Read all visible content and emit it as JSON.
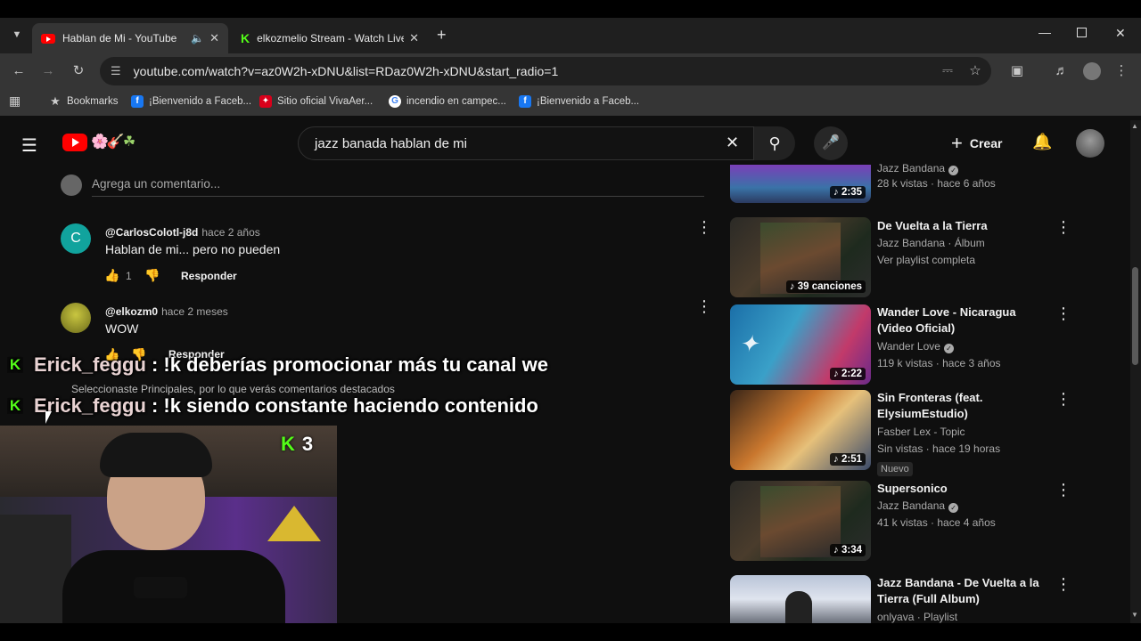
{
  "browser": {
    "tabs": [
      {
        "title": "Hablan de Mi - YouTube",
        "icon": "youtube-icon"
      },
      {
        "title": "elkozmelio Stream - Watch Live",
        "icon": "kick-icon"
      }
    ],
    "address": "youtube.com/watch?v=az0W2h-xDNU&list=RDaz0W2h-xDNU&start_radio=1",
    "bookmarks": [
      {
        "label": "Bookmarks",
        "icon": "star-icon"
      },
      {
        "label": "¡Bienvenido a Faceb...",
        "icon": "facebook-icon"
      },
      {
        "label": "Sitio oficial VivaAer...",
        "icon": "vivaaerobus-icon"
      },
      {
        "label": "incendio en campec...",
        "icon": "google-icon"
      },
      {
        "label": "¡Bienvenido a Faceb...",
        "icon": "facebook-icon"
      }
    ]
  },
  "youtube": {
    "search_query": "jazz banada hablan de mi",
    "create_label": "Crear",
    "add_comment_placeholder": "Agrega un comentario...",
    "comments": [
      {
        "avatar_letter": "C",
        "author": "@CarlosColotl-j8d",
        "time": "hace 2 años",
        "text": "Hablan de mi... pero no pueden",
        "likes": "1",
        "reply_label": "Responder"
      },
      {
        "author": "@elkozm0",
        "time": "hace 2 meses",
        "text": "WOW",
        "reply_label": "Responder"
      }
    ],
    "featured_note": "Seleccionaste Principales, por lo que verás comentarios destacados",
    "sidebar": [
      {
        "title": "",
        "channel": "Jazz Bandana",
        "meta": "28 k vistas · hace 6 años",
        "duration": "2:35",
        "verified": true
      },
      {
        "title": "De Vuelta a la Tierra",
        "channel": "Jazz Bandana · Álbum",
        "meta": "Ver playlist completa",
        "duration": "39 canciones"
      },
      {
        "title": "Wander Love - Nicaragua (Video Oficial)",
        "channel": "Wander Love",
        "meta": "119 k vistas · hace 3 años",
        "duration": "2:22",
        "verified": true
      },
      {
        "title": "Sin Fronteras (feat. ElysiumEstudio)",
        "channel": "Fasber Lex - Topic",
        "meta": "Sin vistas · hace 19 horas",
        "badge": "Nuevo",
        "duration": "2:51"
      },
      {
        "title": "Supersonico",
        "channel": "Jazz Bandana",
        "meta": "41 k vistas · hace 4 años",
        "duration": "3:34",
        "verified": true
      },
      {
        "title": "Jazz Bandana - De Vuelta a la Tierra (Full Album)",
        "channel": "onlyava · Playlist",
        "meta": ""
      }
    ]
  },
  "stream_overlay": {
    "chat": [
      {
        "user": "Erick_feggu",
        "message": ": !k deberías promocionar más tu canal we"
      },
      {
        "user": "Erick_feggu",
        "message": ": !k siendo constante haciendo contenido"
      }
    ],
    "kick_count": "3"
  },
  "colors": {
    "kick_green": "#53fc18",
    "youtube_red": "#ff0000"
  }
}
